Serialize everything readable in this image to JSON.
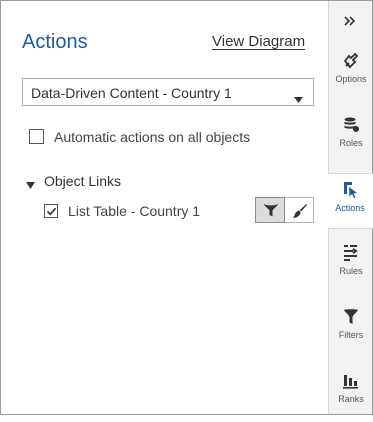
{
  "panel": {
    "title": "Actions",
    "view_diagram_label": "View Diagram",
    "accent_color": "#1f5a9e"
  },
  "target_select": {
    "value": "Data-Driven Content - Country 1"
  },
  "automatic_actions": {
    "label": "Automatic actions on all objects",
    "checked": false
  },
  "object_links": {
    "header": "Object Links",
    "expanded": true,
    "items": [
      {
        "label": "List Table - Country 1",
        "checked": true,
        "filter_active": true,
        "brush_active": false
      }
    ]
  },
  "rail": {
    "collapse_icon": "double-chevron-right-icon",
    "items": [
      {
        "label": "Options",
        "icon": "options-icon",
        "active": false
      },
      {
        "label": "Roles",
        "icon": "roles-icon",
        "active": false
      },
      {
        "label": "Actions",
        "icon": "actions-icon",
        "active": true
      },
      {
        "label": "Rules",
        "icon": "rules-icon",
        "active": false
      },
      {
        "label": "Filters",
        "icon": "filter-icon",
        "active": false
      },
      {
        "label": "Ranks",
        "icon": "ranks-icon",
        "active": false
      }
    ]
  }
}
